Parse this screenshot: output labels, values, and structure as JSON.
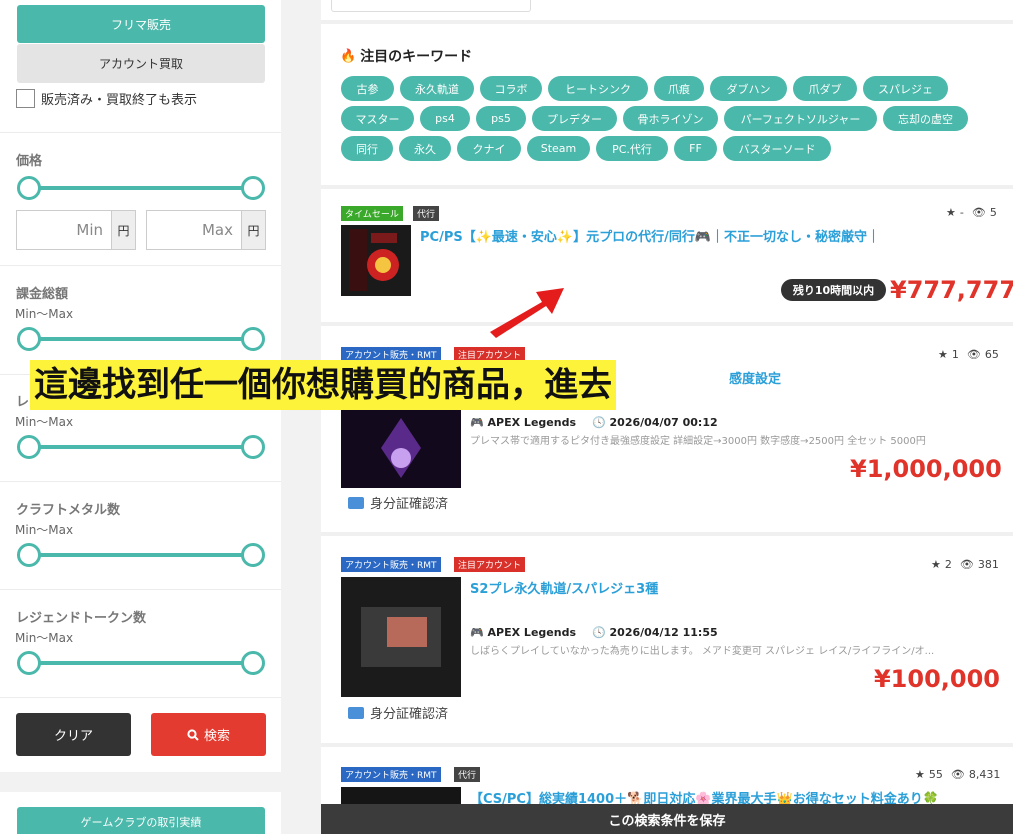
{
  "sidebar": {
    "sell_label": "フリマ販売",
    "buy_label": "アカウント買取",
    "show_sold_label": "販売済み・買取終了も表示",
    "price_label": "価格",
    "min_placeholder": "Min",
    "max_placeholder": "Max",
    "unit": "円",
    "charge_label": "課金総額",
    "range_hint": "Min〜Max",
    "hidden_label": "レ",
    "craft_label": "クラフトメタル数",
    "legend_token_label": "レジェンドトークン数",
    "clear_label": "クリア",
    "search_label": "検索",
    "record_label": "ゲームクラブの取引実績"
  },
  "keywords": {
    "title": "注目のキーワード",
    "tags": [
      "古参",
      "永久軌道",
      "コラボ",
      "ヒートシンク",
      "爪痕",
      "ダブハン",
      "爪ダブ",
      "スパレジェ",
      "マスター",
      "ps4",
      "ps5",
      "プレデター",
      "骨ホライゾン",
      "パーフェクトソルジャー",
      "忘却の虚空",
      "同行",
      "永久",
      "クナイ",
      "Steam",
      "PC.代行",
      "FF",
      "バスターソード"
    ]
  },
  "listings": [
    {
      "badges": [
        "タイムセール",
        "代行"
      ],
      "rating": "-",
      "views": "5",
      "title": "PC/PS【✨最速・安心✨】元プロの代行/同行🎮｜不正一切なし・秘密厳守｜",
      "time_left": "残り10時間以内",
      "price": "¥777,777"
    },
    {
      "badges": [
        "アカウント販売・RMT",
        "注目アカウント"
      ],
      "rating": "1",
      "views": "65",
      "title": "感度設定",
      "game": "APEX Legends",
      "date": "2026/04/07 00:12",
      "desc": "プレマス帯で適用するピタ付き最強感度設定 詳細設定→3000円 数字感度→2500円 全セット 5000円",
      "price": "¥1,000,000",
      "verified": "身分証確認済"
    },
    {
      "badges": [
        "アカウント販売・RMT",
        "注目アカウント"
      ],
      "rating": "2",
      "views": "381",
      "title": "S2プレ永久軌道/スパレジェ3種",
      "game": "APEX Legends",
      "date": "2026/04/12 11:55",
      "desc": "しばらくプレイしていなかった為売りに出します。 メアド変更可 スパレジェ レイス/ライフライン/オ...",
      "price": "¥100,000",
      "verified": "身分証確認済"
    },
    {
      "badges": [
        "アカウント販売・RMT",
        "代行"
      ],
      "rating": "55",
      "views": "8,431",
      "title": "【CS/PC】総実績1400＋🐕即日対応🌸業界最大手👑お得なセット料金あり🍀"
    }
  ],
  "overlay_text": "這邊找到任一個你想購買的商品，進去",
  "save_search_label": "この検索条件を保存",
  "colors": {
    "accent": "#4ab8aa",
    "price": "#e0332a",
    "link": "#2a9fd8",
    "highlight": "#fdf33a"
  }
}
